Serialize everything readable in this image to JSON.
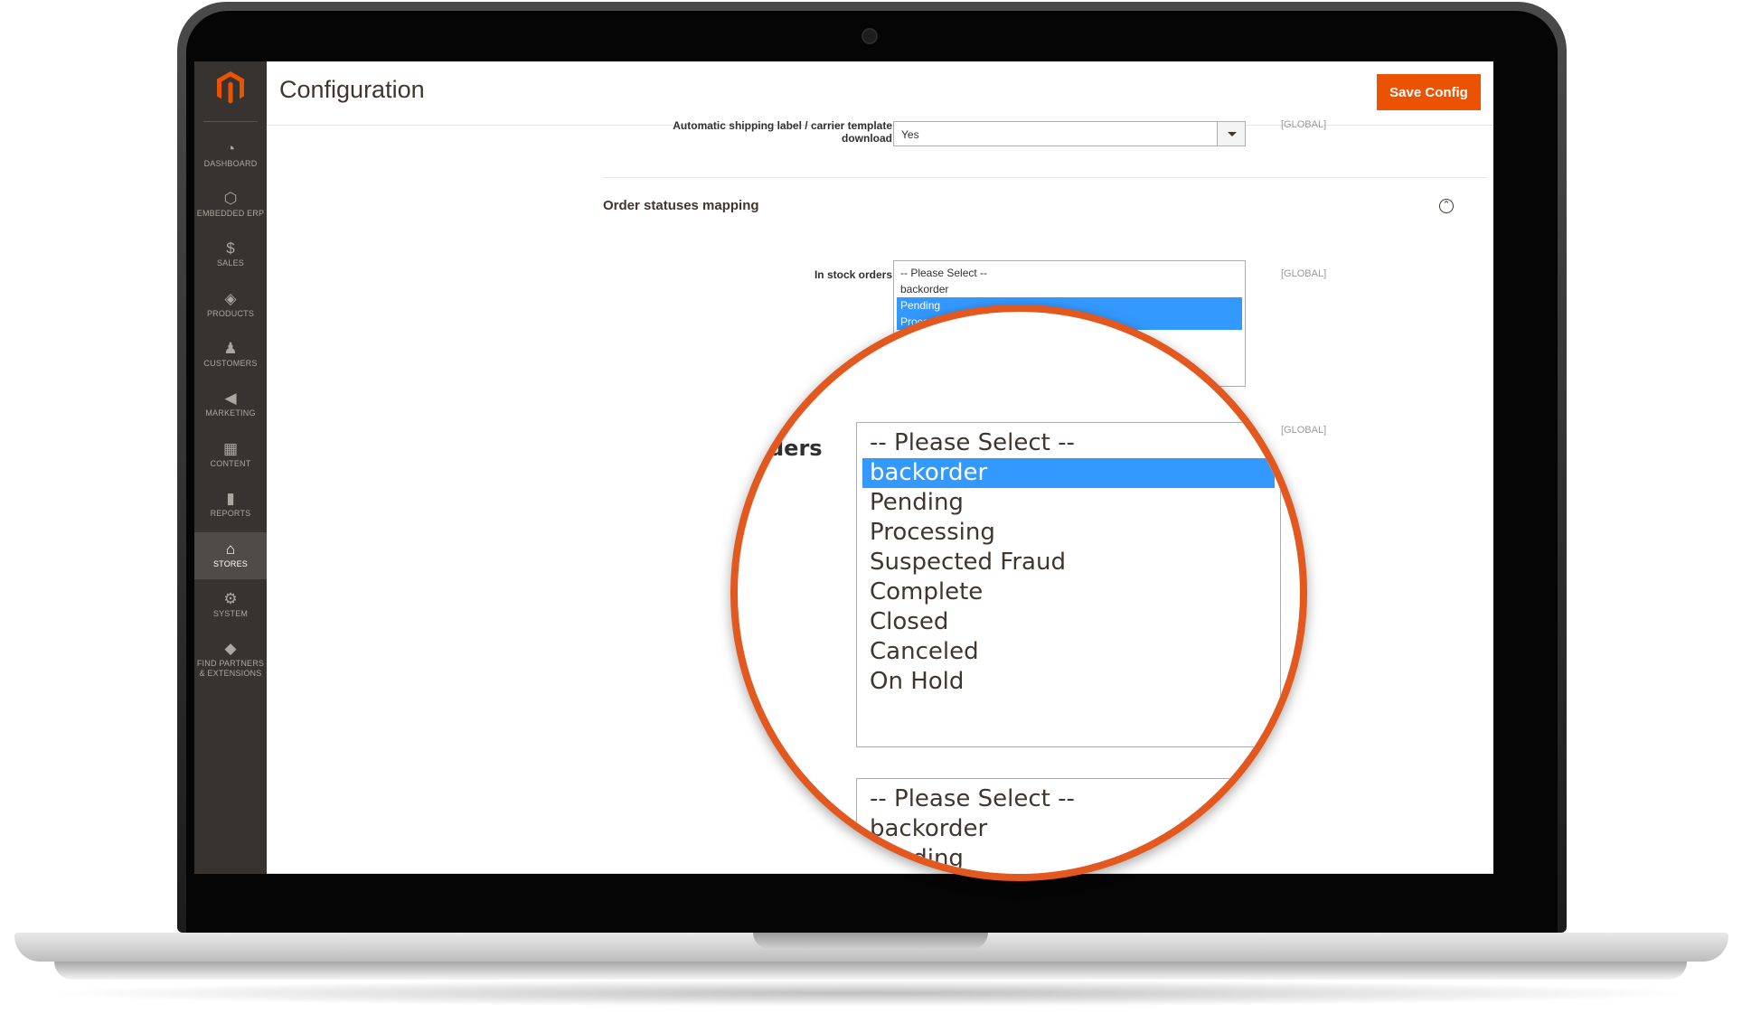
{
  "sidebar": {
    "logo_icon": "magento-logo-icon",
    "items": [
      {
        "label": "DASHBOARD",
        "icon": "dashboard-icon",
        "glyph": "◔"
      },
      {
        "label": "EMBEDDED ERP",
        "icon": "hexagon-icon",
        "glyph": "⬡"
      },
      {
        "label": "SALES",
        "icon": "dollar-icon",
        "glyph": "$"
      },
      {
        "label": "PRODUCTS",
        "icon": "box-icon",
        "glyph": "◈"
      },
      {
        "label": "CUSTOMERS",
        "icon": "person-icon",
        "glyph": "♟"
      },
      {
        "label": "MARKETING",
        "icon": "megaphone-icon",
        "glyph": "◀"
      },
      {
        "label": "CONTENT",
        "icon": "layout-icon",
        "glyph": "▦"
      },
      {
        "label": "REPORTS",
        "icon": "bar-chart-icon",
        "glyph": "▮"
      },
      {
        "label": "STORES",
        "icon": "store-icon",
        "glyph": "⌂"
      },
      {
        "label": "SYSTEM",
        "icon": "gear-icon",
        "glyph": "⚙"
      },
      {
        "label": "FIND PARTNERS",
        "label2": "& EXTENSIONS",
        "icon": "partners-box-icon",
        "glyph": "◆"
      }
    ]
  },
  "header": {
    "title": "Configuration",
    "save_label": "Save Config"
  },
  "config": {
    "shipping_label": {
      "label_line1": "Automatic shipping label / carrier template",
      "label_line2": "download",
      "value": "Yes",
      "scope": "[GLOBAL]"
    },
    "order_status_section": {
      "title": "Order statuses mapping",
      "collapse_glyph": "⌃"
    },
    "in_stock_orders": {
      "label": "In stock orders",
      "scope": "[GLOBAL]",
      "options": [
        "-- Please Select --",
        "backorder",
        "Pending",
        "Processing",
        "Suspected"
      ],
      "selected": [
        false,
        false,
        true,
        true,
        false
      ]
    },
    "second_scope": "[GLOBAL]",
    "third_scope_partial": "AL]"
  },
  "magnifier": {
    "label_partial": "ders",
    "top_select_options": [
      "-- Please Select --",
      "backorder",
      "Pending",
      "Processing",
      "Suspected Fraud",
      "Complete",
      "Closed",
      "Canceled",
      "On Hold"
    ],
    "top_select_selected": [
      false,
      true,
      false,
      false,
      false,
      false,
      false,
      false,
      false
    ],
    "bottom_select_options": [
      "-- Please Select --",
      "backorder",
      "Pending"
    ],
    "scope_top": "[GLOBAL]",
    "scope_mid": "AL]"
  },
  "colors": {
    "accent": "#eb5202",
    "sidebar": "#373330",
    "selection": "#3399ff",
    "magnifier_ring": "#e2581f"
  }
}
